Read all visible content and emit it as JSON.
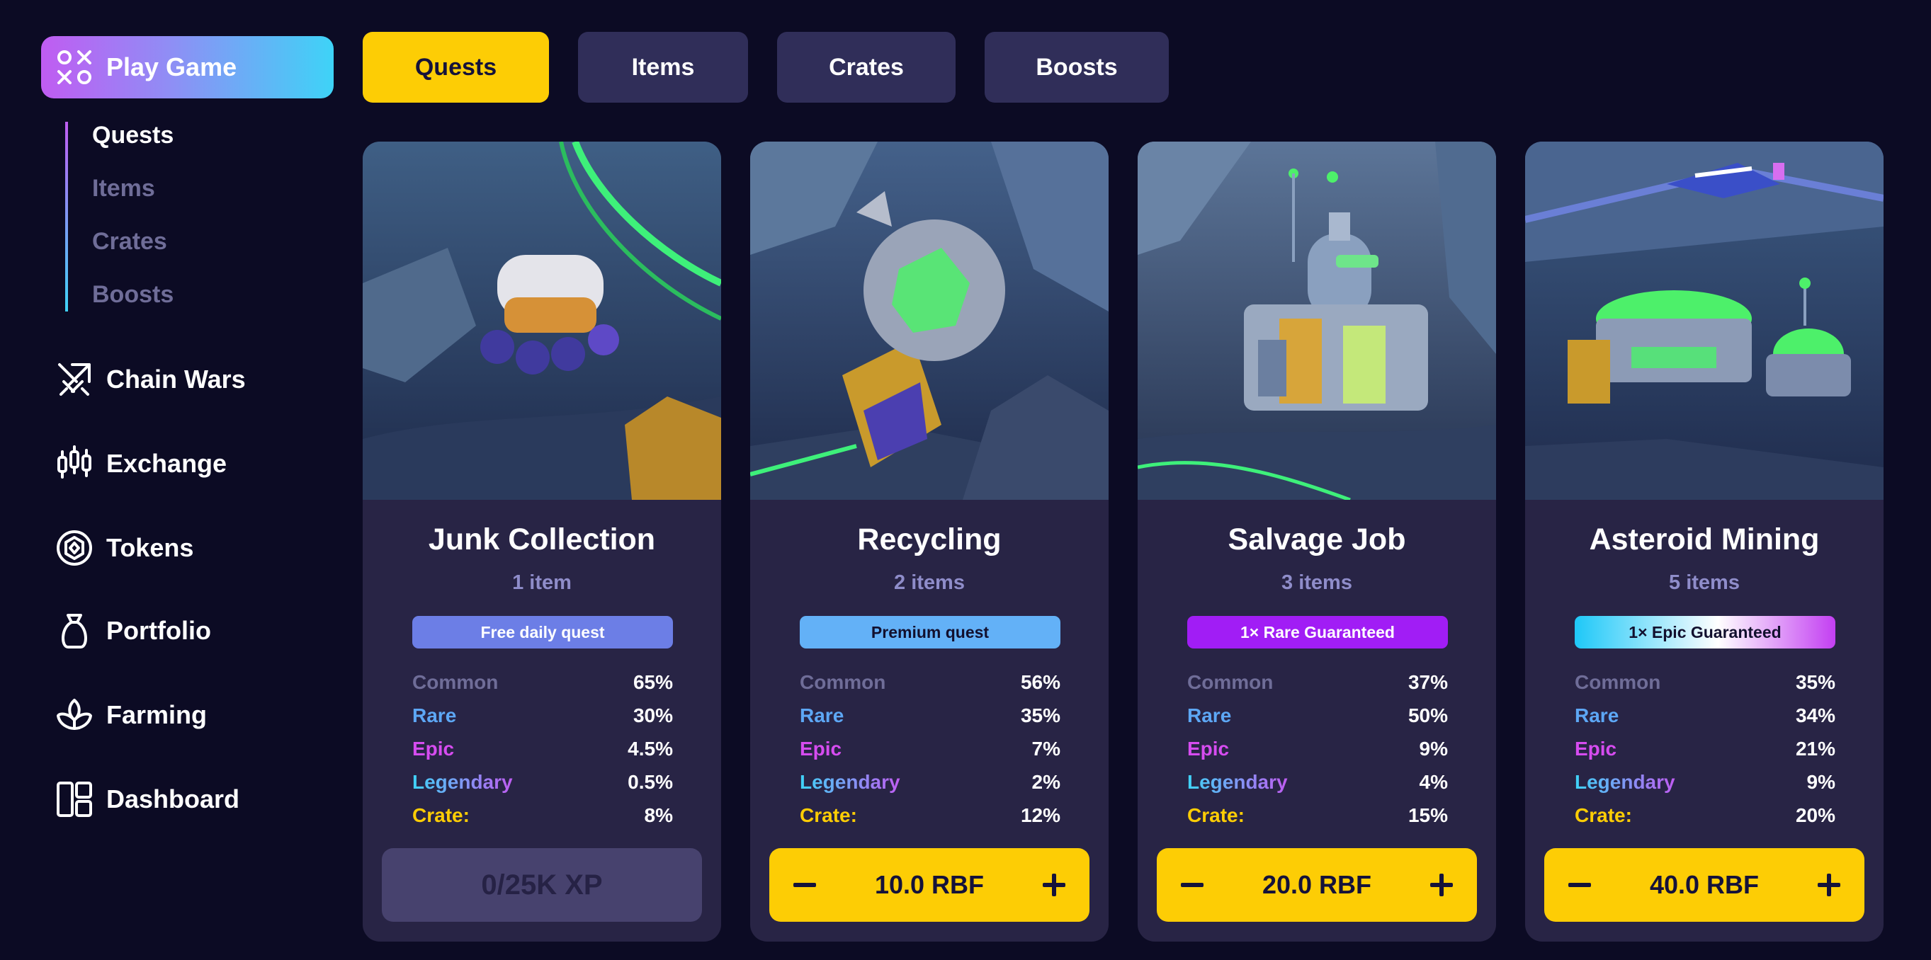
{
  "sidebar": {
    "play_label": "Play Game",
    "sub_items": [
      {
        "label": "Quests",
        "active": true
      },
      {
        "label": "Items",
        "active": false
      },
      {
        "label": "Crates",
        "active": false
      },
      {
        "label": "Boosts",
        "active": false
      }
    ],
    "nav_items": [
      {
        "label": "Chain Wars",
        "icon": "crossed-swords-icon"
      },
      {
        "label": "Exchange",
        "icon": "candlestick-icon"
      },
      {
        "label": "Tokens",
        "icon": "token-coin-icon"
      },
      {
        "label": "Portfolio",
        "icon": "money-bag-icon"
      },
      {
        "label": "Farming",
        "icon": "plant-icon"
      },
      {
        "label": "Dashboard",
        "icon": "dashboard-grid-icon"
      }
    ]
  },
  "tabs": [
    {
      "label": "Quests",
      "active": true
    },
    {
      "label": "Items",
      "active": false
    },
    {
      "label": "Crates",
      "active": false
    },
    {
      "label": "Boosts",
      "active": false
    }
  ],
  "rarity_labels": {
    "common": "Common",
    "rare": "Rare",
    "epic": "Epic",
    "legendary": "Legendary",
    "crate": "Crate:"
  },
  "quests": [
    {
      "title": "Junk Collection",
      "item_count": "1 item",
      "badge": "Free daily quest",
      "odds": {
        "common": "65%",
        "rare": "30%",
        "epic": "4.5%",
        "legendary": "0.5%",
        "crate": "8%"
      },
      "action_label": "0/25K XP"
    },
    {
      "title": "Recycling",
      "item_count": "2 items",
      "badge": "Premium quest",
      "odds": {
        "common": "56%",
        "rare": "35%",
        "epic": "7%",
        "legendary": "2%",
        "crate": "12%"
      },
      "action_label": "10.0 RBF"
    },
    {
      "title": "Salvage Job",
      "item_count": "3 items",
      "badge": "1× Rare Guaranteed",
      "odds": {
        "common": "37%",
        "rare": "50%",
        "epic": "9%",
        "legendary": "4%",
        "crate": "15%"
      },
      "action_label": "20.0 RBF"
    },
    {
      "title": "Asteroid Mining",
      "item_count": "5 items",
      "badge": "1× Epic Guaranteed",
      "odds": {
        "common": "35%",
        "rare": "34%",
        "epic": "21%",
        "legendary": "9%",
        "crate": "20%"
      },
      "action_label": "40.0 RBF"
    }
  ],
  "colors": {
    "background": "#0c0b24",
    "card": "#282445",
    "accent_yellow": "#fdcd05",
    "tab_inactive": "#302e59",
    "rare": "#5da7f5",
    "epic": "#d64cf0"
  }
}
